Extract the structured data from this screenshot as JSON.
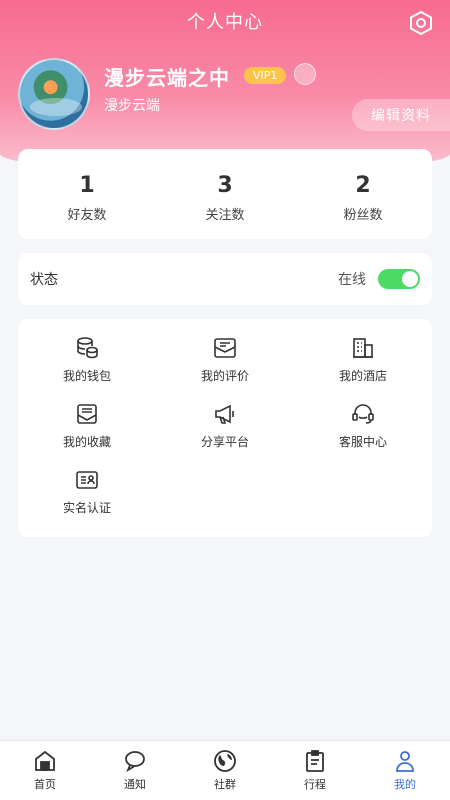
{
  "header": {
    "title": "个人中心",
    "settings_icon": "gear-hex-icon"
  },
  "profile": {
    "name": "漫步云端之中",
    "vip": "VIP1",
    "subname": "漫步云端",
    "edit_label": "编辑资料"
  },
  "stats": [
    {
      "value": "1",
      "label": "好友数"
    },
    {
      "value": "3",
      "label": "关注数"
    },
    {
      "value": "2",
      "label": "粉丝数"
    }
  ],
  "status": {
    "label": "状态",
    "value": "在线",
    "toggle_on": true
  },
  "menu": [
    {
      "label": "我的钱包",
      "icon": "wallet-icon"
    },
    {
      "label": "我的评价",
      "icon": "review-icon"
    },
    {
      "label": "我的酒店",
      "icon": "hotel-icon"
    },
    {
      "label": "我的收藏",
      "icon": "favorites-icon"
    },
    {
      "label": "分享平台",
      "icon": "megaphone-icon"
    },
    {
      "label": "客服中心",
      "icon": "headset-icon"
    },
    {
      "label": "实名认证",
      "icon": "id-card-icon"
    }
  ],
  "tabs": [
    {
      "label": "首页",
      "icon": "home-icon"
    },
    {
      "label": "通知",
      "icon": "chat-bubble-icon"
    },
    {
      "label": "社群",
      "icon": "globe-icon"
    },
    {
      "label": "行程",
      "icon": "clipboard-icon"
    },
    {
      "label": "我的",
      "icon": "person-icon",
      "active": true
    }
  ],
  "colors": {
    "header_pink": "#f76b8f",
    "vip_badge": "#ffc34d",
    "toggle_green": "#4cd964",
    "active_tab": "#3a6fd8"
  }
}
